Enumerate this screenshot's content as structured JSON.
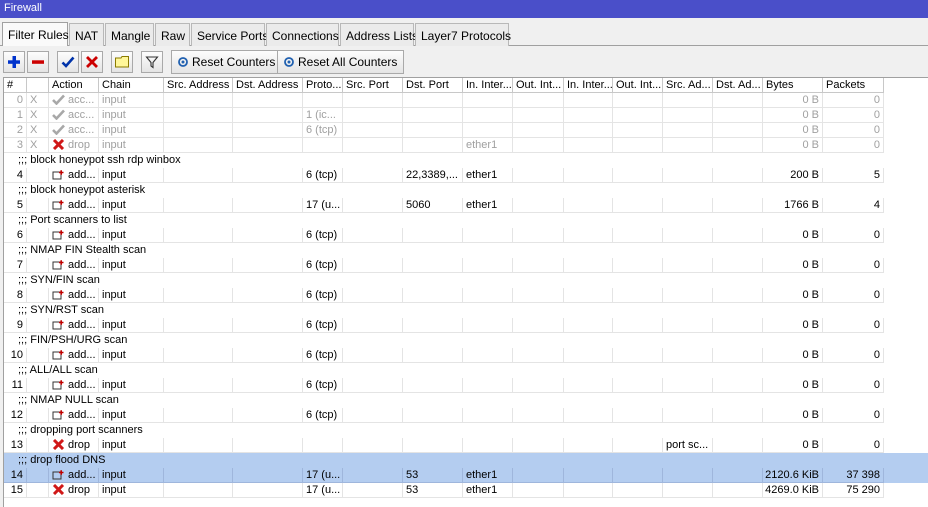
{
  "window": {
    "title": "Firewall"
  },
  "tabs": [
    "Filter Rules",
    "NAT",
    "Mangle",
    "Raw",
    "Service Ports",
    "Connections",
    "Address Lists",
    "Layer7 Protocols"
  ],
  "toolbar": {
    "reset_counters": "Reset Counters",
    "reset_all_counters": "Reset All Counters"
  },
  "columns": [
    "#",
    "",
    "Action",
    "Chain",
    "Src. Address",
    "Dst. Address",
    "Proto...",
    "Src. Port",
    "Dst. Port",
    "In. Inter...",
    "Out. Int...",
    "In. Inter...",
    "Out. Int...",
    "Src. Ad...",
    "Dst. Ad...",
    "Bytes",
    "Packets"
  ],
  "rows": [
    {
      "kind": "rule",
      "num": "0",
      "flag": "X",
      "icon": "accept",
      "action": "acc...",
      "chain": "input",
      "proto": "",
      "dst_port": "",
      "in_iface": "",
      "src_list": "",
      "bytes": "0 B",
      "packets": "0",
      "disabled": true
    },
    {
      "kind": "rule",
      "num": "1",
      "flag": "X",
      "icon": "accept",
      "action": "acc...",
      "chain": "input",
      "proto": "1 (ic...",
      "dst_port": "",
      "in_iface": "",
      "src_list": "",
      "bytes": "0 B",
      "packets": "0",
      "disabled": true
    },
    {
      "kind": "rule",
      "num": "2",
      "flag": "X",
      "icon": "accept",
      "action": "acc...",
      "chain": "input",
      "proto": "6 (tcp)",
      "dst_port": "",
      "in_iface": "",
      "src_list": "",
      "bytes": "0 B",
      "packets": "0",
      "disabled": true
    },
    {
      "kind": "rule",
      "num": "3",
      "flag": "X",
      "icon": "drop",
      "action": "drop",
      "chain": "input",
      "proto": "",
      "dst_port": "",
      "in_iface": "ether1",
      "src_list": "",
      "bytes": "0 B",
      "packets": "0",
      "disabled": true
    },
    {
      "kind": "comment",
      "text": ";;; block honeypot ssh rdp winbox"
    },
    {
      "kind": "rule",
      "num": "4",
      "flag": "",
      "icon": "add",
      "action": "add...",
      "chain": "input",
      "proto": "6 (tcp)",
      "dst_port": "22,3389,...",
      "in_iface": "ether1",
      "src_list": "",
      "bytes": "200 B",
      "packets": "5",
      "disabled": false
    },
    {
      "kind": "comment",
      "text": ";;; block honeypot asterisk"
    },
    {
      "kind": "rule",
      "num": "5",
      "flag": "",
      "icon": "add",
      "action": "add...",
      "chain": "input",
      "proto": "17 (u...",
      "dst_port": "5060",
      "in_iface": "ether1",
      "src_list": "",
      "bytes": "1766 B",
      "packets": "4",
      "disabled": false
    },
    {
      "kind": "comment",
      "text": ";;; Port scanners to list"
    },
    {
      "kind": "rule",
      "num": "6",
      "flag": "",
      "icon": "add",
      "action": "add...",
      "chain": "input",
      "proto": "6 (tcp)",
      "dst_port": "",
      "in_iface": "",
      "src_list": "",
      "bytes": "0 B",
      "packets": "0",
      "disabled": false
    },
    {
      "kind": "comment",
      "text": ";;; NMAP FIN Stealth scan"
    },
    {
      "kind": "rule",
      "num": "7",
      "flag": "",
      "icon": "add",
      "action": "add...",
      "chain": "input",
      "proto": "6 (tcp)",
      "dst_port": "",
      "in_iface": "",
      "src_list": "",
      "bytes": "0 B",
      "packets": "0",
      "disabled": false
    },
    {
      "kind": "comment",
      "text": ";;; SYN/FIN scan"
    },
    {
      "kind": "rule",
      "num": "8",
      "flag": "",
      "icon": "add",
      "action": "add...",
      "chain": "input",
      "proto": "6 (tcp)",
      "dst_port": "",
      "in_iface": "",
      "src_list": "",
      "bytes": "0 B",
      "packets": "0",
      "disabled": false
    },
    {
      "kind": "comment",
      "text": ";;; SYN/RST scan"
    },
    {
      "kind": "rule",
      "num": "9",
      "flag": "",
      "icon": "add",
      "action": "add...",
      "chain": "input",
      "proto": "6 (tcp)",
      "dst_port": "",
      "in_iface": "",
      "src_list": "",
      "bytes": "0 B",
      "packets": "0",
      "disabled": false
    },
    {
      "kind": "comment",
      "text": ";;; FIN/PSH/URG scan"
    },
    {
      "kind": "rule",
      "num": "10",
      "flag": "",
      "icon": "add",
      "action": "add...",
      "chain": "input",
      "proto": "6 (tcp)",
      "dst_port": "",
      "in_iface": "",
      "src_list": "",
      "bytes": "0 B",
      "packets": "0",
      "disabled": false
    },
    {
      "kind": "comment",
      "text": ";;; ALL/ALL scan"
    },
    {
      "kind": "rule",
      "num": "11",
      "flag": "",
      "icon": "add",
      "action": "add...",
      "chain": "input",
      "proto": "6 (tcp)",
      "dst_port": "",
      "in_iface": "",
      "src_list": "",
      "bytes": "0 B",
      "packets": "0",
      "disabled": false
    },
    {
      "kind": "comment",
      "text": ";;; NMAP NULL scan"
    },
    {
      "kind": "rule",
      "num": "12",
      "flag": "",
      "icon": "add",
      "action": "add...",
      "chain": "input",
      "proto": "6 (tcp)",
      "dst_port": "",
      "in_iface": "",
      "src_list": "",
      "bytes": "0 B",
      "packets": "0",
      "disabled": false
    },
    {
      "kind": "comment",
      "text": ";;; dropping port scanners"
    },
    {
      "kind": "rule",
      "num": "13",
      "flag": "",
      "icon": "drop",
      "action": "drop",
      "chain": "input",
      "proto": "",
      "dst_port": "",
      "in_iface": "",
      "src_list": "port sc...",
      "bytes": "0 B",
      "packets": "0",
      "disabled": false
    },
    {
      "kind": "comment",
      "text": ";;; drop flood DNS",
      "selected": true
    },
    {
      "kind": "rule",
      "num": "14",
      "flag": "",
      "icon": "add",
      "action": "add...",
      "chain": "input",
      "proto": "17 (u...",
      "dst_port": "53",
      "in_iface": "ether1",
      "src_list": "",
      "bytes": "2120.6 KiB",
      "packets": "37 398",
      "disabled": false,
      "selected": true
    },
    {
      "kind": "rule",
      "num": "15",
      "flag": "",
      "icon": "drop",
      "action": "drop",
      "chain": "input",
      "proto": "17 (u...",
      "dst_port": "53",
      "in_iface": "ether1",
      "src_list": "",
      "bytes": "4269.0 KiB",
      "packets": "75 290",
      "disabled": false
    }
  ],
  "colors": {
    "title_bar": "#4a4fc9",
    "selection": "#b4cdf0",
    "add_icon": "#0033cc",
    "remove_icon": "#cc0000",
    "drop_icon": "#d01818"
  },
  "icons": [
    "add-icon",
    "remove-icon",
    "enable-check-icon",
    "disable-x-icon",
    "comment-icon",
    "filter-icon",
    "reset-counters-icon",
    "reset-all-counters-icon"
  ]
}
